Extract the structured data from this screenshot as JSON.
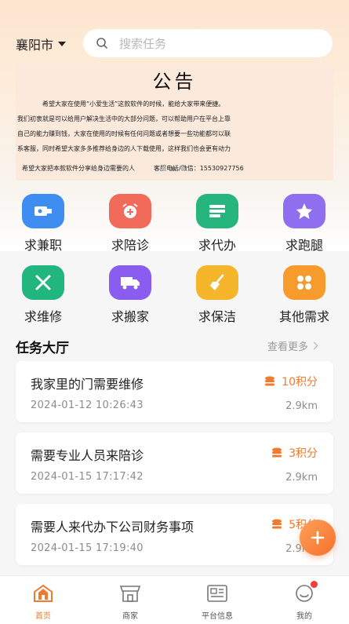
{
  "header": {
    "city": "襄阳市",
    "search_placeholder": "搜索任务"
  },
  "notice": {
    "title": "公告",
    "line1": "希望大家在使用“小爱生活”这款软件的时候，能给大家带来便捷。",
    "line2": "我们初衷就是可以给用户解决生活中的大部分问题，可以帮助用户在平台上靠",
    "line3": "自己的能力赚到钱，大家在使用的时候有任何问题或者想要一些功能都可以联",
    "line4": "系客服，同时希望大家多多推荐给身边的人下载使用，这样我们也会更有动力",
    "line5": "希望大家把本款软件分享给身边需要的人",
    "contact": "客服电话/微信：15530927756"
  },
  "services": [
    {
      "label": "求兼职",
      "icon": "usb-drive-icon",
      "color": "#3d8ef0"
    },
    {
      "label": "求陪诊",
      "icon": "alarm-clock-icon",
      "color": "#f26a5a"
    },
    {
      "label": "求代办",
      "icon": "list-icon",
      "color": "#26b67d"
    },
    {
      "label": "求跑腿",
      "icon": "star-icon",
      "color": "#8f6ff0"
    },
    {
      "label": "求维修",
      "icon": "tools-icon",
      "color": "#22b67f"
    },
    {
      "label": "求搬家",
      "icon": "truck-icon",
      "color": "#8a5cf0"
    },
    {
      "label": "求保洁",
      "icon": "broom-icon",
      "color": "#f6b62c"
    },
    {
      "label": "其他需求",
      "icon": "grid-icon",
      "color": "#f69b2c"
    }
  ],
  "hall": {
    "title": "任务大厅",
    "more": "查看更多"
  },
  "tasks": [
    {
      "title": "我家里的门需要维修",
      "date": "2024-01-12 10:26:43",
      "points": "10积分",
      "distance": "2.9km"
    },
    {
      "title": "需要专业人员来陪诊",
      "date": "2024-01-15 17:17:42",
      "points": "3积分",
      "distance": "2.9km"
    },
    {
      "title": "需要人来代办下公司财务事项",
      "date": "2024-01-15 17:19:40",
      "points": "5积分",
      "distance": "2.9km"
    }
  ],
  "tabs": [
    {
      "label": "首页",
      "icon": "home-icon"
    },
    {
      "label": "商家",
      "icon": "shop-icon"
    },
    {
      "label": "平台信息",
      "icon": "info-board-icon"
    },
    {
      "label": "我的",
      "icon": "smile-icon"
    }
  ],
  "colors": {
    "accent": "#f07a2e",
    "badge": "#f23b3b"
  }
}
